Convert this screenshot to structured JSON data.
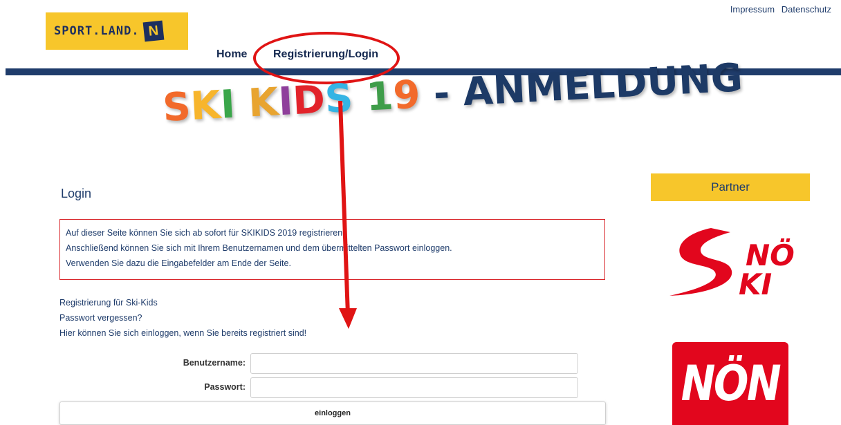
{
  "header": {
    "top_links": [
      "Impressum",
      "Datenschutz"
    ],
    "logo_text": "SPORT.LAND.",
    "logo_badge": "N"
  },
  "nav": {
    "home": "Home",
    "register_login": "Registrierung/Login"
  },
  "banner": {
    "letters": [
      {
        "char": "S",
        "color": "#f26a2b"
      },
      {
        "char": "K",
        "color": "#f7b52c"
      },
      {
        "char": "I",
        "color": "#3aa64a"
      },
      {
        "char": " ",
        "color": "#000000"
      },
      {
        "char": "K",
        "color": "#e8a430"
      },
      {
        "char": "I",
        "color": "#8f3f9b"
      },
      {
        "char": "D",
        "color": "#e2232a"
      },
      {
        "char": "S",
        "color": "#35b4e4"
      },
      {
        "char": " ",
        "color": "#000000"
      },
      {
        "char": "1",
        "color": "#3f9d4a"
      },
      {
        "char": "9",
        "color": "#f26a2b"
      }
    ],
    "suffix": " - ANMELDUNG",
    "suffix_color": "#1d3a66"
  },
  "login": {
    "title": "Login",
    "notice": [
      "Auf dieser Seite können Sie sich ab sofort für SKIKIDS 2019 registrieren.",
      "Anschließend können Sie sich mit Ihrem Benutzernamen und dem übermittelten Passwort einloggen.",
      "Verwenden Sie dazu die Eingabefelder am Ende der Seite."
    ],
    "links": {
      "register": "Registrierung für Ski-Kids",
      "forgot": "Passwort vergessen?",
      "hint": "Hier können Sie sich einloggen, wenn Sie bereits registriert sind!"
    },
    "username_label": "Benutzername:",
    "password_label": "Passwort:",
    "username_value": "",
    "password_value": "",
    "submit": "einloggen"
  },
  "sidebar": {
    "partner_title": "Partner",
    "sponsor1_line1": "NÖ",
    "sponsor1_line2": "KI",
    "sponsor2": "NÖN"
  },
  "colors": {
    "brand_yellow": "#f7c62b",
    "brand_navy": "#1f3c6b",
    "annotation_red": "#e01414"
  }
}
